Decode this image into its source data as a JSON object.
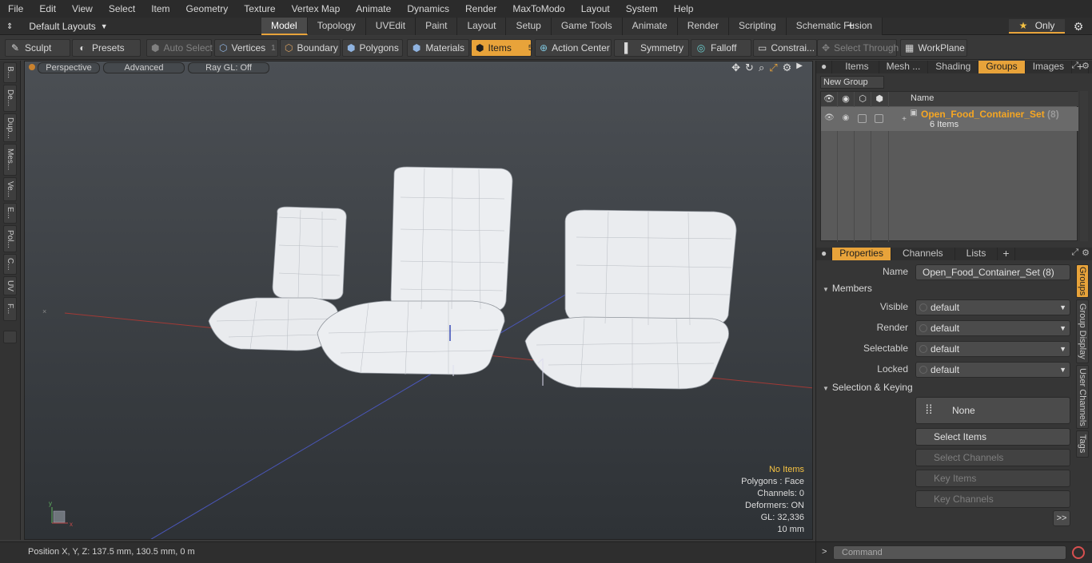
{
  "menu": [
    "File",
    "Edit",
    "View",
    "Select",
    "Item",
    "Geometry",
    "Texture",
    "Vertex Map",
    "Animate",
    "Dynamics",
    "Render",
    "MaxToModo",
    "Layout",
    "System",
    "Help"
  ],
  "layout_dropdown": "Default Layouts",
  "layout_tabs": [
    {
      "label": "Model",
      "active": true
    },
    {
      "label": "Topology"
    },
    {
      "label": "UVEdit"
    },
    {
      "label": "Paint"
    },
    {
      "label": "Layout"
    },
    {
      "label": "Setup"
    },
    {
      "label": "Game Tools"
    },
    {
      "label": "Animate"
    },
    {
      "label": "Render"
    },
    {
      "label": "Scripting"
    },
    {
      "label": "Schematic Fusion"
    }
  ],
  "tab_add": "+",
  "only_label": "Only",
  "toolbar": {
    "sculpt": "Sculpt",
    "presets": "Presets",
    "auto_select": "Auto Select",
    "vertices": "Vertices",
    "vertices_count": "1",
    "boundary": "Boundary",
    "polygons": "Polygons",
    "materials": "Materials",
    "items": "Items",
    "items_count": "5",
    "action_center": "Action Center",
    "symmetry": "Symmetry",
    "falloff": "Falloff",
    "constraints": "Constrai...",
    "select_through": "Select Through",
    "workplane": "WorkPlane"
  },
  "left_tabs": [
    "B...",
    "De...",
    "Dup...",
    "Mes...",
    "Ve...",
    "E...",
    "Pol...",
    "C...",
    "UV",
    "F..."
  ],
  "viewport": {
    "perspective": "Perspective",
    "advanced": "Advanced",
    "raygl": "Ray GL: Off",
    "info": {
      "items": "No Items",
      "polygons": "Polygons : Face",
      "channels": "Channels: 0",
      "deformers": "Deformers: ON",
      "gl": "GL: 32,336",
      "scale": "10 mm"
    }
  },
  "status": {
    "position": "Position X, Y, Z:   137.5 mm, 130.5 mm, 0 m"
  },
  "top_panel": {
    "tabs": [
      {
        "label": "Items"
      },
      {
        "label": "Mesh ..."
      },
      {
        "label": "Shading"
      },
      {
        "label": "Groups",
        "active": true
      },
      {
        "label": "Images"
      }
    ],
    "new_group": "New Group",
    "name_header": "Name",
    "group_name": "Open_Food_Container_Set",
    "group_count": "(8)",
    "group_sub": "6 Items"
  },
  "props_panel": {
    "tabs": [
      {
        "label": "Properties",
        "active": true
      },
      {
        "label": "Channels"
      },
      {
        "label": "Lists"
      }
    ],
    "name_label": "Name",
    "name_value": "Open_Food_Container_Set (8)",
    "members_section": "Members",
    "visible_label": "Visible",
    "visible_value": "default",
    "render_label": "Render",
    "render_value": "default",
    "selectable_label": "Selectable",
    "selectable_value": "default",
    "locked_label": "Locked",
    "locked_value": "default",
    "selection_section": "Selection & Keying",
    "none_label": "None",
    "select_items": "Select Items",
    "select_channels": "Select Channels",
    "key_items": "Key Items",
    "key_channels": "Key Channels",
    "more": ">>"
  },
  "side_tabs": [
    "Groups",
    "Group Display",
    "User Channels",
    "Tags"
  ],
  "command": {
    "prompt": ">",
    "placeholder": "Command"
  },
  "colors": {
    "accent": "#e8a33a",
    "group_name": "#f5a623",
    "info_highlight": "#f5c242"
  }
}
